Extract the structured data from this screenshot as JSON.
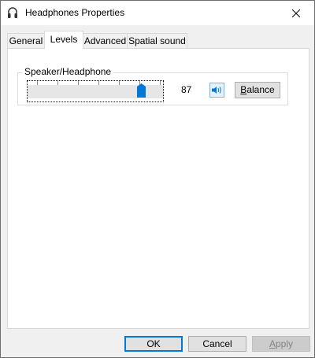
{
  "window": {
    "title": "Headphones Properties"
  },
  "tabs": [
    {
      "label": "General"
    },
    {
      "label": "Levels"
    },
    {
      "label": "Advanced"
    },
    {
      "label": "Spatial sound"
    }
  ],
  "active_tab": "Levels",
  "levels": {
    "group_label": "Speaker/Headphone",
    "volume_value": "87",
    "volume_fraction": 0.87,
    "balance_label": "Balance",
    "balance_accesskey": "B"
  },
  "footer": {
    "ok_label": "OK",
    "cancel_label": "Cancel",
    "apply_label": "Apply",
    "apply_accesskey": "A"
  },
  "icons": {
    "app": "headphones-icon",
    "close": "close-icon",
    "speaker": "speaker-icon"
  },
  "colors": {
    "accent": "#0078d7",
    "speaker_button_bg": "#e5f1fb"
  }
}
